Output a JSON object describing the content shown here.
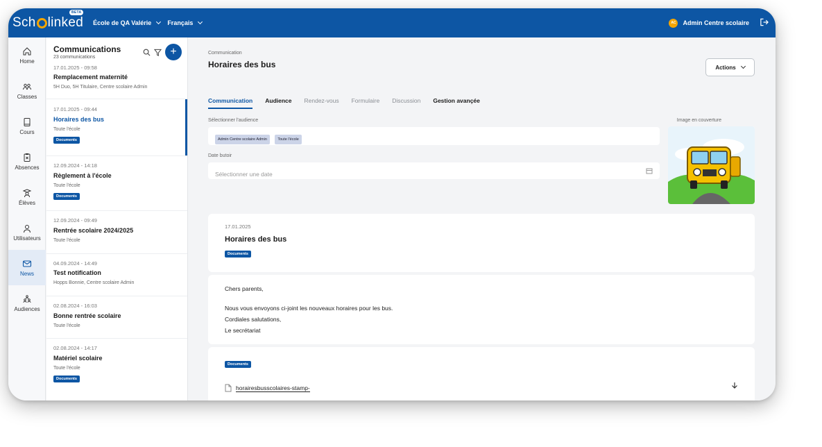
{
  "topbar": {
    "logo_left": "Sch",
    "logo_right": "linked",
    "beta": "BETA",
    "school": "École de QA Valérie",
    "language": "Français",
    "avatar_initials": "AC",
    "user": "Admin Centre scolaire"
  },
  "nav": [
    {
      "label": "Home",
      "icon": "home-icon"
    },
    {
      "label": "Classes",
      "icon": "classes-icon"
    },
    {
      "label": "Cours",
      "icon": "book-icon"
    },
    {
      "label": "Absences",
      "icon": "clipboard-icon"
    },
    {
      "label": "Élèves",
      "icon": "student-icon"
    },
    {
      "label": "Utilisateurs",
      "icon": "user-icon"
    },
    {
      "label": "News",
      "icon": "mail-icon",
      "active": true
    },
    {
      "label": "Audiences",
      "icon": "audience-icon"
    }
  ],
  "list": {
    "title": "Communications",
    "count": "23 communications",
    "items": [
      {
        "date": "17.01.2025 - 09:58",
        "title": "Remplacement maternité",
        "sub": "5H Duo, 5H Titulaire, Centre scolaire Admin",
        "badge": ""
      },
      {
        "date": "17.01.2025 - 09:44",
        "title": "Horaires des bus",
        "sub": "Toute l'école",
        "badge": "Documents",
        "active": true
      },
      {
        "date": "12.09.2024 - 14:18",
        "title": "Règlement à l'école",
        "sub": "Toute l'école",
        "badge": "Documents"
      },
      {
        "date": "12.09.2024 - 09:49",
        "title": "Rentrée scolaire 2024/2025",
        "sub": "Toute l'école",
        "badge": ""
      },
      {
        "date": "04.09.2024 - 14:49",
        "title": "Test notification",
        "sub": "Hopps Bonnie, Centre scolaire Admin",
        "badge": ""
      },
      {
        "date": "02.08.2024 - 16:03",
        "title": "Bonne rentrée scolaire",
        "sub": "Toute l'école",
        "badge": ""
      },
      {
        "date": "02.08.2024 - 14:17",
        "title": "Matériel scolaire",
        "sub": "Toute l'école",
        "badge": "Documents"
      }
    ]
  },
  "main": {
    "breadcrumb": "Communication",
    "title": "Horaires des bus",
    "actions_label": "Actions",
    "tabs": [
      "Communication",
      "Audience",
      "Rendez-vous",
      "Formulaire",
      "Discussion",
      "Gestion avançée"
    ],
    "audience_label": "Sélectionner l'audience",
    "audience_chips": [
      "Admin Centre scolaire Admin",
      "Toute l'école"
    ],
    "deadline_label": "Date butoir",
    "deadline_placeholder": "Sélectionner une date",
    "cover_label": "Image en couverture",
    "post": {
      "date": "17.01.2025",
      "title": "Horaires des bus",
      "badge": "Documents",
      "greeting": "Chers parents,",
      "line1": "Nous vous envoyons ci-joint les nouveaux horaires pour les bus.",
      "line2": "Cordiales salutations,",
      "line3": "Le secrétariat",
      "docs_badge": "Documents",
      "file_name": "horairesbusscolaires-stamp-"
    }
  },
  "colors": {
    "brand": "#0d56a4",
    "accent": "#f6a500"
  }
}
